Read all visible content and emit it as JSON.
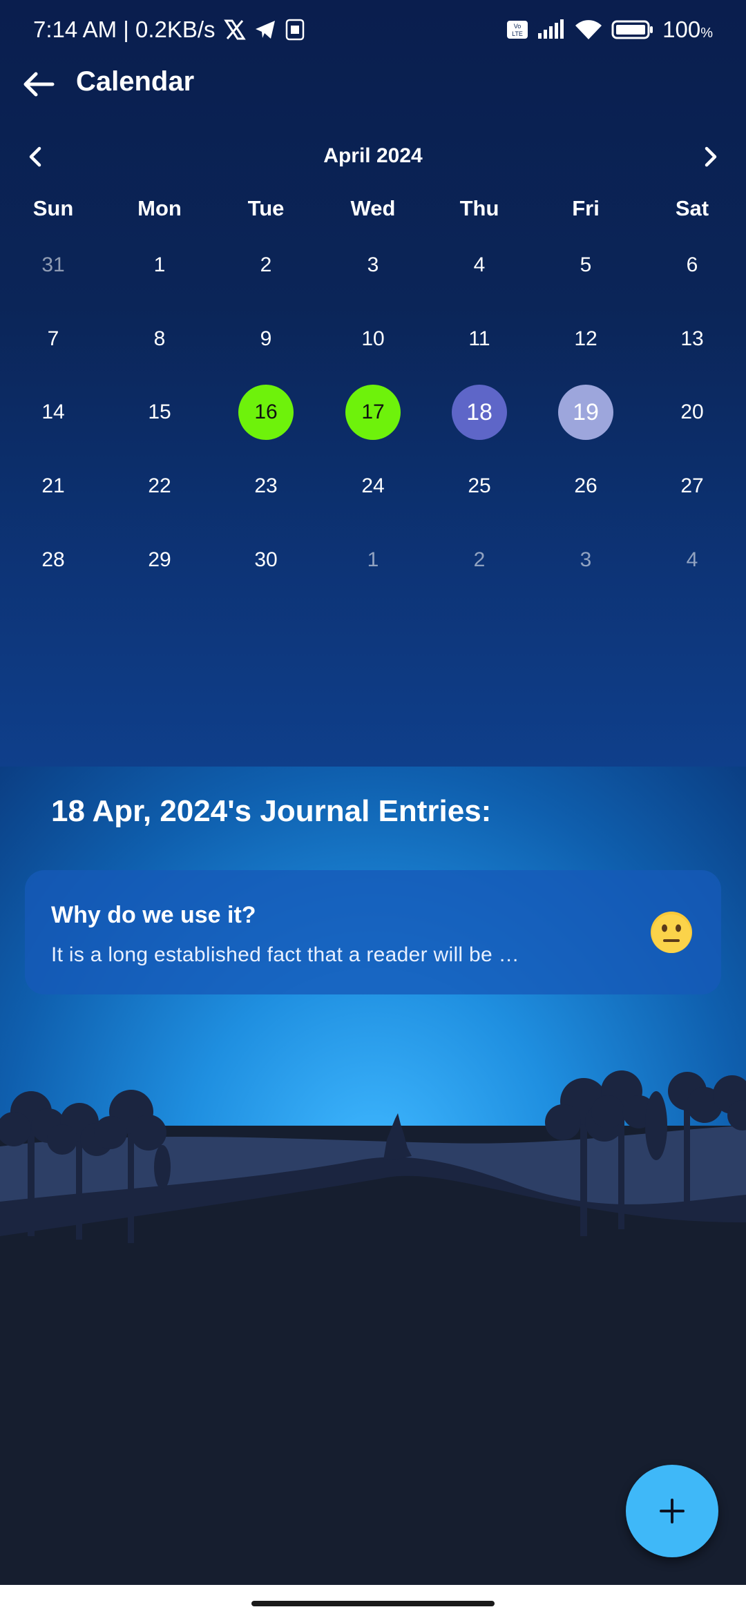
{
  "status_bar": {
    "time_speed": "7:14 AM | 0.2KB/s",
    "battery": "100"
  },
  "app_bar": {
    "title": "Calendar"
  },
  "calendar": {
    "month_label": "April 2024",
    "weekdays": [
      "Sun",
      "Mon",
      "Tue",
      "Wed",
      "Thu",
      "Fri",
      "Sat"
    ],
    "weeks": [
      [
        "31",
        "1",
        "2",
        "3",
        "4",
        "5",
        "6"
      ],
      [
        "7",
        "8",
        "9",
        "10",
        "11",
        "12",
        "13"
      ],
      [
        "14",
        "15",
        "16",
        "17",
        "18",
        "19",
        "20"
      ],
      [
        "21",
        "22",
        "23",
        "24",
        "25",
        "26",
        "27"
      ],
      [
        "28",
        "29",
        "30",
        "1",
        "2",
        "3",
        "4"
      ]
    ],
    "highlight_colors": {
      "green": "#6ef20b",
      "selected": "#5e66c8",
      "light": "#9da6dc"
    }
  },
  "journal": {
    "heading": "18 Apr, 2024's Journal Entries:",
    "entries": [
      {
        "title": "Why do we use it?",
        "snippet": "It is a long established fact that a reader will be …",
        "mood_icon": "neutral-face-icon"
      }
    ]
  },
  "fab": {
    "icon": "plus-icon"
  }
}
